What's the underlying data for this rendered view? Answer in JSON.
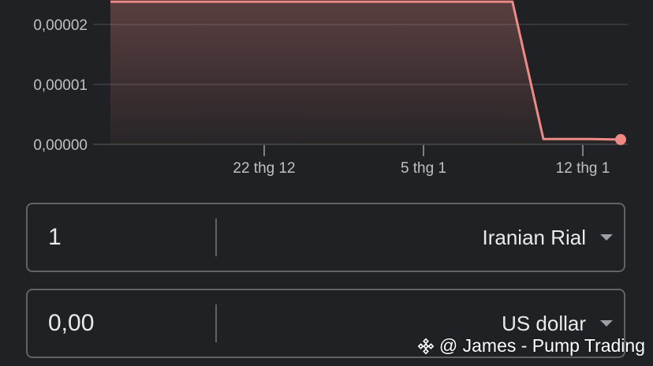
{
  "chart_data": {
    "type": "area",
    "x_ticks": [
      "22 thg 12",
      "5 thg 1",
      "12 thg 1"
    ],
    "y_ticks": [
      "0,00000",
      "0,00001",
      "0,00002"
    ],
    "ylim": [
      0,
      2.4e-05
    ],
    "series": [
      {
        "points": [
          {
            "x": "2024-12-12",
            "y": 2.38e-05
          },
          {
            "x": "2025-01-07",
            "y": 2.38e-05
          },
          {
            "x": "2025-01-09",
            "y": 9e-07
          },
          {
            "x": "2025-01-12",
            "y": 9e-07
          },
          {
            "x": "2025-01-14",
            "y": 8e-07
          }
        ]
      }
    ],
    "line_color": "#ee8a86",
    "grid": true
  },
  "converter": {
    "from": {
      "amount": "1",
      "currency": "Iranian Rial"
    },
    "to": {
      "amount": "0,00",
      "currency": "US dollar"
    }
  },
  "watermark": {
    "text": "@ James - Pump Trading",
    "icon": "binance-diamond-icon"
  }
}
